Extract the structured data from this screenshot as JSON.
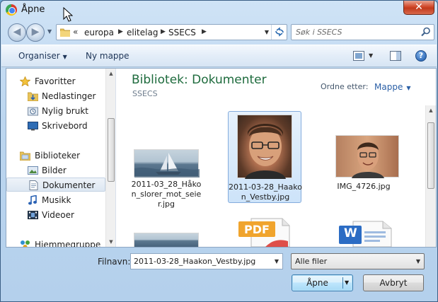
{
  "window": {
    "title": "Åpne",
    "close_label": "✕"
  },
  "navigation": {
    "breadcrumb_overflow": "«",
    "breadcrumb": [
      "europa",
      "elitelag",
      "SSECS"
    ],
    "search_placeholder": "Søk i SSECS"
  },
  "toolbar": {
    "organize_label": "Organiser",
    "new_folder_label": "Ny mappe",
    "help_label": "?"
  },
  "sidebar": {
    "favorites_label": "Favoritter",
    "favorites": [
      "Nedlastinger",
      "Nylig brukt",
      "Skrivebord"
    ],
    "libraries_label": "Biblioteker",
    "libraries": [
      "Bilder",
      "Dokumenter",
      "Musikk",
      "Videoer"
    ],
    "selected_library": "Dokumenter",
    "homegroup_label": "Hjemmegruppe"
  },
  "main": {
    "library_title": "Bibliotek: Dokumenter",
    "library_subtitle": "SSECS",
    "sort_label": "Ordne etter:",
    "sort_value": "Mappe",
    "files": [
      {
        "name": "2011-03_28_Håkon_slorer_mot_seier.jpg",
        "type": "image",
        "selected": false
      },
      {
        "name": "2011-03-28_Haakon_Vestby.jpg",
        "type": "image",
        "selected": true
      },
      {
        "name": "IMG_4726.jpg",
        "type": "image",
        "selected": false
      }
    ],
    "partial_files": [
      {
        "type": "image"
      },
      {
        "type": "pdf",
        "badge": "PDF"
      },
      {
        "type": "word",
        "badge": "W"
      }
    ]
  },
  "footer": {
    "filename_label": "Filnavn:",
    "filename_value": "2011-03-28_Haakon_Vestby.jpg",
    "filter_value": "Alle filer",
    "open_label": "Åpne",
    "cancel_label": "Avbryt"
  },
  "colors": {
    "title_green": "#1e6b3d",
    "link_blue": "#2a5fa6",
    "selection": "#cde3f9"
  }
}
